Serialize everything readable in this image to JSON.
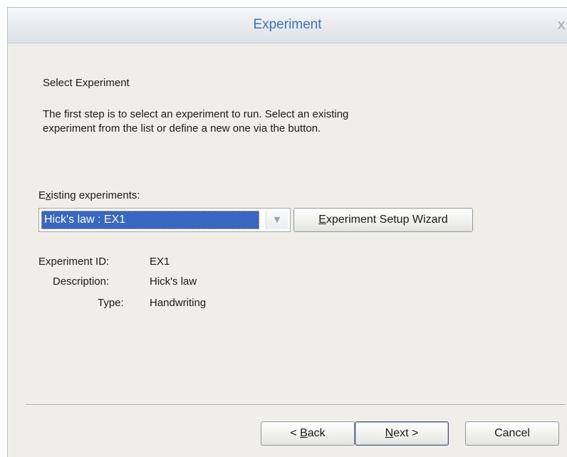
{
  "window": {
    "title": "Experiment",
    "close_label": "x"
  },
  "header": {
    "heading": "Select Experiment",
    "description_line1": "The first step is to select an experiment to run. Select an existing",
    "description_line2": "experiment from the list or define a new one via the button."
  },
  "experiments": {
    "label_prefix": "E",
    "label_mnemonic": "x",
    "label_rest": "isting experiments:",
    "selected_value": "Hick's law : EX1",
    "dropdown_arrow_icon": "chevron-down-icon"
  },
  "wizard_button": {
    "mnemonic": "E",
    "rest": "xperiment Setup Wizard"
  },
  "details": {
    "id_label": "Experiment ID:",
    "id_value": "EX1",
    "description_label": "Description:",
    "description_value": "Hick's law",
    "type_label": "Type:",
    "type_value": "Handwriting"
  },
  "footer": {
    "back_prefix": "< ",
    "back_mnemonic": "B",
    "back_rest": "ack",
    "next_mnemonic": "N",
    "next_rest": "ext >",
    "cancel_label": "Cancel"
  },
  "colors": {
    "title": "#3e73b0",
    "selection": "#3767c1",
    "dialog_bg": "#efeee8"
  }
}
